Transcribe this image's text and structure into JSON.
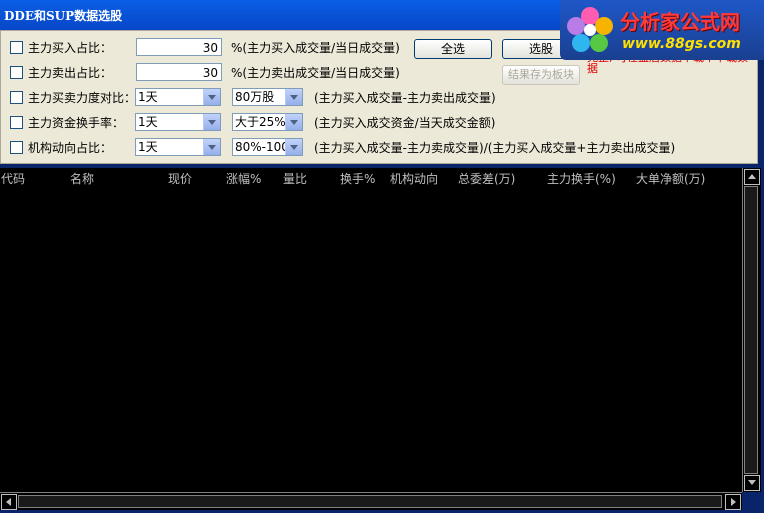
{
  "window": {
    "title": "DDE和SUP数据选股"
  },
  "logo": {
    "text_cn": "分析家公式网",
    "url_text": "www.88gs.com"
  },
  "filters": [
    {
      "label": "主力买入占比：",
      "value": "30",
      "desc": "%(主力买入成交量/当日成交量)"
    },
    {
      "label": "主力卖出占比：",
      "value": "30",
      "desc": "%(主力卖出成交量/当日成交量)"
    },
    {
      "label": "主力买卖力度对比：",
      "period": "1天",
      "threshold": "80万股",
      "desc": "(主力买入成交量-主力卖出成交量)"
    },
    {
      "label": "主力资金换手率：",
      "period": "1天",
      "threshold": "大于25%",
      "desc": "(主力买入成交资金/当天成交金额)"
    },
    {
      "label": "机构动向占比：",
      "period": "1天",
      "threshold": "80%-100%",
      "desc": "(主力买入成交量-主力卖成交量)/(主力买入成交量+主力卖出成交量)"
    }
  ],
  "buttons": {
    "select_all": "全选",
    "pick": "选股",
    "save_block": "结果存为板块"
  },
  "note": "完整, 可在盘后数据下载中下载数据",
  "table": {
    "columns": [
      "代码",
      "名称",
      "现价",
      "涨幅%",
      "量比",
      "换手%",
      "机构动向",
      "总委差(万)",
      "主力换手(%)",
      "大单净额(万)"
    ]
  }
}
